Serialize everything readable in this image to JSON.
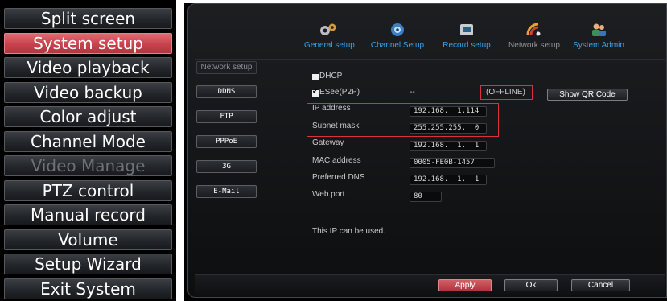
{
  "menu": {
    "items": [
      {
        "label": "Split screen",
        "state": "normal"
      },
      {
        "label": "System setup",
        "state": "active"
      },
      {
        "label": "Video playback",
        "state": "normal"
      },
      {
        "label": "Video backup",
        "state": "normal"
      },
      {
        "label": "Color adjust",
        "state": "normal"
      },
      {
        "label": "Channel Mode",
        "state": "normal"
      },
      {
        "label": "Video Manage",
        "state": "disabled"
      },
      {
        "label": "PTZ control",
        "state": "normal"
      },
      {
        "label": "Manual record",
        "state": "normal"
      },
      {
        "label": "Volume",
        "state": "normal"
      },
      {
        "label": "Setup Wizard",
        "state": "normal"
      },
      {
        "label": "Exit System",
        "state": "normal"
      }
    ]
  },
  "top_tabs": [
    {
      "label": "General setup",
      "icon": "gears-icon"
    },
    {
      "label": "Channel Setup",
      "icon": "camera-icon"
    },
    {
      "label": "Record setup",
      "icon": "record-device-icon"
    },
    {
      "label": "Network setup",
      "icon": "network-icon",
      "current": true
    },
    {
      "label": "System Admin",
      "icon": "users-icon"
    }
  ],
  "side_tabs": [
    {
      "label": "Network setup",
      "current": true
    },
    {
      "label": "DDNS"
    },
    {
      "label": "FTP"
    },
    {
      "label": "PPPoE"
    },
    {
      "label": "3G"
    },
    {
      "label": "E-Mail"
    }
  ],
  "form": {
    "dhcp_label": "DHCP",
    "dhcp_checked": false,
    "esee_label": "ESee(P2P)",
    "esee_checked": true,
    "esee_id": "--",
    "esee_status": "(OFFLINE)",
    "show_qr_label": "Show QR Code",
    "ip_label": "IP address",
    "ip_value": "192.168.  1.114",
    "subnet_label": "Subnet mask",
    "subnet_value": "255.255.255.  0",
    "gateway_label": "Gateway",
    "gateway_value": "192.168.  1.  1",
    "mac_label": "MAC address",
    "mac_value": "0005-FE0B-1457",
    "dns_label": "Preferred DNS",
    "dns_value": "192.168.  1.  1",
    "webport_label": "Web port",
    "webport_value": "80",
    "status_message": "This IP can be used."
  },
  "buttons": {
    "apply": "Apply",
    "ok": "Ok",
    "cancel": "Cancel"
  },
  "colors": {
    "active_menu": "#c7434d",
    "tab_label": "#3aa3e8",
    "highlight_box": "#d8333a"
  }
}
